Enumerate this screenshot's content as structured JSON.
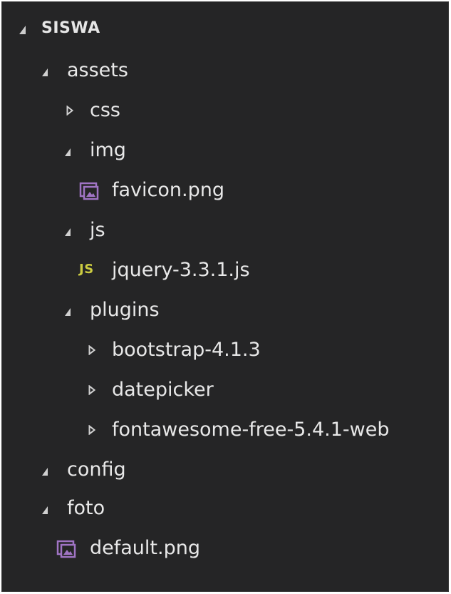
{
  "explorer": {
    "section_title": "SISWA",
    "items": [
      {
        "label": "assets",
        "kind": "folder",
        "state": "expanded",
        "icon": "chevron-down-icon"
      },
      {
        "label": "css",
        "kind": "folder",
        "state": "collapsed",
        "icon": "chevron-right-icon"
      },
      {
        "label": "img",
        "kind": "folder",
        "state": "expanded",
        "icon": "chevron-down-icon"
      },
      {
        "label": "favicon.png",
        "kind": "file",
        "icon": "image-file-icon"
      },
      {
        "label": "js",
        "kind": "folder",
        "state": "expanded",
        "icon": "chevron-down-icon"
      },
      {
        "label": "jquery-3.3.1.js",
        "kind": "file",
        "icon": "js-file-icon",
        "icon_text": "JS"
      },
      {
        "label": "plugins",
        "kind": "folder",
        "state": "expanded",
        "icon": "chevron-down-icon"
      },
      {
        "label": "bootstrap-4.1.3",
        "kind": "folder",
        "state": "collapsed",
        "icon": "chevron-right-icon"
      },
      {
        "label": "datepicker",
        "kind": "folder",
        "state": "collapsed",
        "icon": "chevron-right-icon"
      },
      {
        "label": "fontawesome-free-5.4.1-web",
        "kind": "folder",
        "state": "collapsed",
        "icon": "chevron-right-icon"
      },
      {
        "label": "config",
        "kind": "folder",
        "state": "expanded",
        "icon": "chevron-down-icon"
      },
      {
        "label": "foto",
        "kind": "folder",
        "state": "expanded",
        "icon": "chevron-down-icon"
      },
      {
        "label": "default.png",
        "kind": "file",
        "icon": "image-file-icon"
      }
    ]
  },
  "colors": {
    "background": "#252526",
    "text": "#e8e8e8",
    "js_icon": "#cbcb41",
    "image_icon": "#a074c4"
  }
}
